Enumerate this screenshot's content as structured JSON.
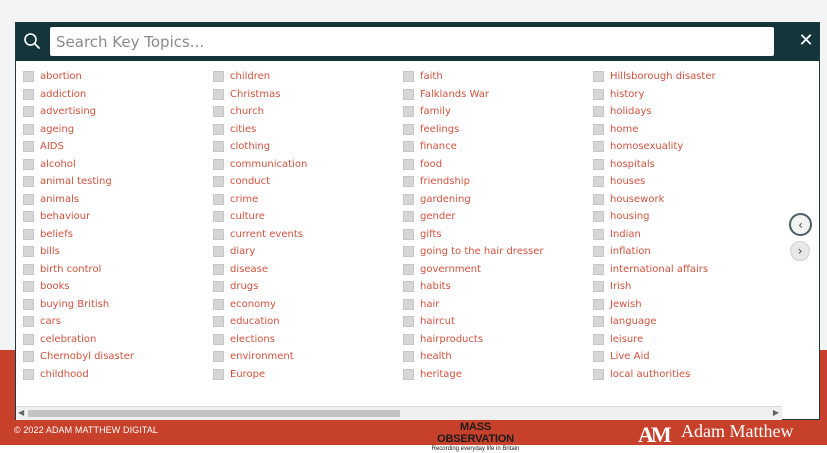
{
  "search": {
    "placeholder": "Search Key Topics...",
    "close_label": "✕"
  },
  "topics": {
    "columns": [
      [
        "abortion",
        "addiction",
        "advertising",
        "ageing",
        "AIDS",
        "alcohol",
        "animal testing",
        "animals",
        "behaviour",
        "beliefs",
        "bills",
        "birth control",
        "books",
        "buying British",
        "cars",
        "celebration",
        "Chernobyl disaster",
        "childhood"
      ],
      [
        "children",
        "Christmas",
        "church",
        "cities",
        "clothing",
        "communication",
        "conduct",
        "crime",
        "culture",
        "current events",
        "diary",
        "disease",
        "drugs",
        "economy",
        "education",
        "elections",
        "environment",
        "Europe"
      ],
      [
        "faith",
        "Falklands War",
        "family",
        "feelings",
        "finance",
        "food",
        "friendship",
        "gardening",
        "gender",
        "gifts",
        "going to the hair dresser",
        "government",
        "habits",
        "hair",
        "haircut",
        "hairproducts",
        "health",
        "heritage"
      ],
      [
        "Hillsborough disaster",
        "history",
        "holidays",
        "home",
        "homosexuality",
        "hospitals",
        "houses",
        "housework",
        "housing",
        "Indian",
        "inflation",
        "international affairs",
        "Irish",
        "Jewish",
        "language",
        "leisure",
        "Live Aid",
        "local authorities"
      ]
    ]
  },
  "nav": {
    "prev_label": "‹",
    "next_label": "›"
  },
  "footer": {
    "copyright": "© 2022 ADAM MATTHEW DIGITAL",
    "mo_title": "MASS OBSERVATION",
    "mo_subtitle": "Recording everyday life in Britain",
    "am_mark": "AM",
    "am_name": "Adam Matthew"
  },
  "colors": {
    "header_bg": "#14363a",
    "topic_text": "#d0523e",
    "footer_red": "#c7402a"
  }
}
